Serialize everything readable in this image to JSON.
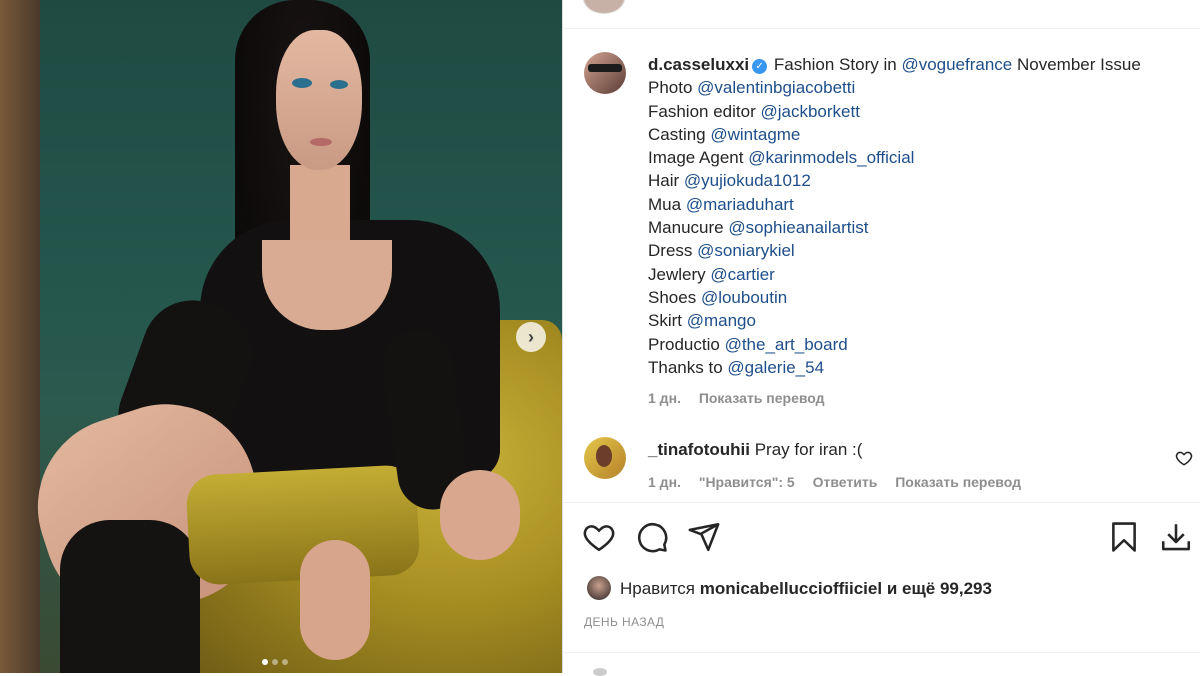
{
  "photo": {
    "next_icon": "chevron-right-icon",
    "carousel_dots": 3,
    "active_dot": 1
  },
  "post": {
    "username": "d.casseluxxi",
    "caption_text": "Fashion Story in",
    "caption_mention": "@voguefrance",
    "caption_tail": "November Issue",
    "credits": [
      {
        "label": "Photo",
        "handle": "@valentinbgiacobetti"
      },
      {
        "label": "Fashion editor",
        "handle": "@jackborkett"
      },
      {
        "label": "Casting",
        "handle": "@wintagme"
      },
      {
        "label": "Image Agent",
        "handle": "@karinmodels_official"
      },
      {
        "label": "Hair",
        "handle": "@yujiokuda1012"
      },
      {
        "label": "Mua",
        "handle": "@mariaduhart"
      },
      {
        "label": "Manucure",
        "handle": "@sophieanailartist"
      },
      {
        "label": "Dress",
        "handle": "@soniarykiel"
      },
      {
        "label": "Jewlery",
        "handle": "@cartier"
      },
      {
        "label": "Shoes",
        "handle": "@louboutin"
      },
      {
        "label": "Skirt",
        "handle": "@mango"
      },
      {
        "label": "Productio",
        "handle": "@the_art_board"
      },
      {
        "label": "Thanks to",
        "handle": "@galerie_54"
      }
    ],
    "time": "1 дн.",
    "translate": "Показать перевод"
  },
  "comment": {
    "username": "_tinafotouhii",
    "text": "Pray for iran :(",
    "time": "1 дн.",
    "likes": "\"Нравится\": 5",
    "reply": "Ответить",
    "translate": "Показать перевод"
  },
  "likes": {
    "prefix": "Нравится",
    "user": "monicabelluccioffiiciel",
    "suffix": "и ещё 99,293"
  },
  "date": "ДЕНЬ НАЗАД"
}
